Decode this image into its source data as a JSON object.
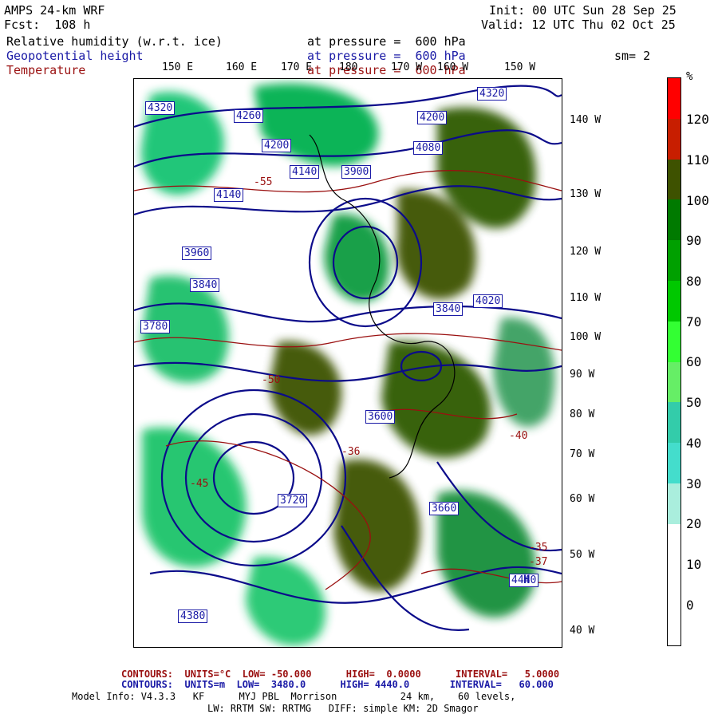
{
  "header": {
    "model": "AMPS 24-km WRF",
    "fcst": "Fcst:  108 h",
    "init": "Init: 00 UTC Sun 28 Sep 25",
    "valid": "Valid: 12 UTC Thu 02 Oct 25",
    "fields": [
      {
        "name": "Relative humidity (w.r.t. ice)",
        "level": "at pressure =  600 hPa",
        "color": "#000000"
      },
      {
        "name": "Geopotential height",
        "level": "at pressure =  600 hPa",
        "color": "#1a1aa6"
      },
      {
        "name": "Temperature",
        "level": "at pressure =  600 hPa",
        "color": "#9a1010"
      }
    ],
    "smoothing": "sm= 2"
  },
  "map": {
    "lon_labels": [
      "150 E",
      "160 E",
      "170 E",
      "180",
      "170 W",
      "160 W",
      "150 W"
    ],
    "lat_labels": [
      "140 W",
      "130 W",
      "120 W",
      "110 W",
      "100 W",
      "90 W",
      "80 W",
      "70 W",
      "60 W",
      "50 W",
      "40 W"
    ],
    "height_labels": [
      "4320",
      "4260",
      "4200",
      "4080",
      "4140",
      "3900",
      "3840",
      "3720",
      "3780",
      "3960",
      "4020",
      "4440",
      "4380",
      "3660",
      "3600"
    ],
    "extra_labels": [
      "-55",
      "-35",
      "-40",
      "-45",
      "-37",
      "-50",
      "-36",
      "H"
    ]
  },
  "colorbar": {
    "unit": "%",
    "labels": [
      "120",
      "110",
      "100",
      "90",
      "80",
      "70",
      "60",
      "50",
      "40",
      "30",
      "20",
      "10",
      "0"
    ],
    "colors": [
      "#ff0000",
      "#c81e00",
      "#3e5200",
      "#007a00",
      "#00a000",
      "#00c800",
      "#33ff33",
      "#66ee66",
      "#33ccaa",
      "#44ddcc",
      "#aaeedd",
      "#ffffff",
      "#ffffff",
      "#ffffff"
    ]
  },
  "footer": {
    "temp_contours": "CONTOURS:  UNITS=°C  LOW= -50.000      HIGH=  0.0000      INTERVAL=   5.0000",
    "height_contours": "CONTOURS:  UNITS=m  LOW=  3480.0      HIGH= 4440.0       INTERVAL=   60.000",
    "model_info": "Model Info: V4.3.3   KF      MYJ PBL  Morrison           24 km,    60 levels,",
    "model_info2": "LW: RRTM SW: RRTMG   DIFF: simple KM: 2D Smagor"
  }
}
